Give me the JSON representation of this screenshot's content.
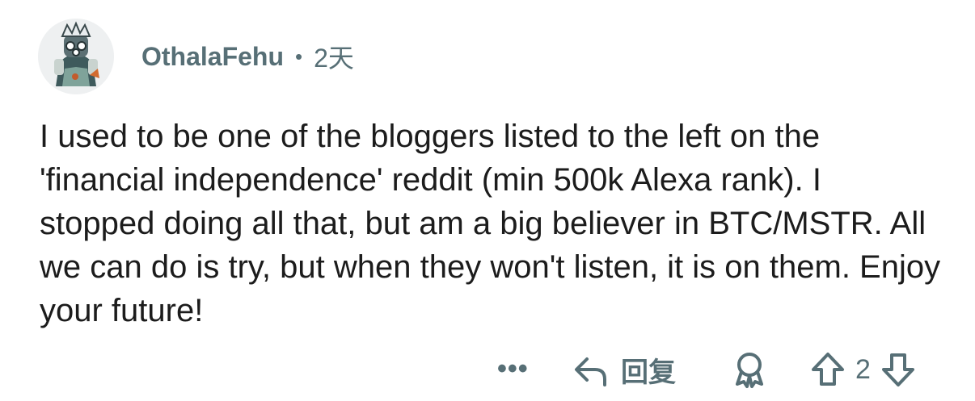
{
  "comment": {
    "author": "OthalaFehu",
    "separator": "•",
    "time": "2天",
    "body": "I used to be one of the bloggers listed to the left on the 'financial independence' reddit (min 500k Alexa rank). I stopped doing all that, but am a big believer in BTC/MSTR. All we can do is try, but when they won't listen, it is on them. Enjoy your future!",
    "actions": {
      "more": "•••",
      "reply_label": "回复",
      "vote_count": "2"
    }
  },
  "colors": {
    "meta_text": "#576f76",
    "body_text": "#1c1c1c",
    "background": "#ffffff"
  },
  "icons": [
    "avatar",
    "reply-arrow-icon",
    "award-icon",
    "upvote-icon",
    "downvote-icon",
    "more-icon"
  ]
}
